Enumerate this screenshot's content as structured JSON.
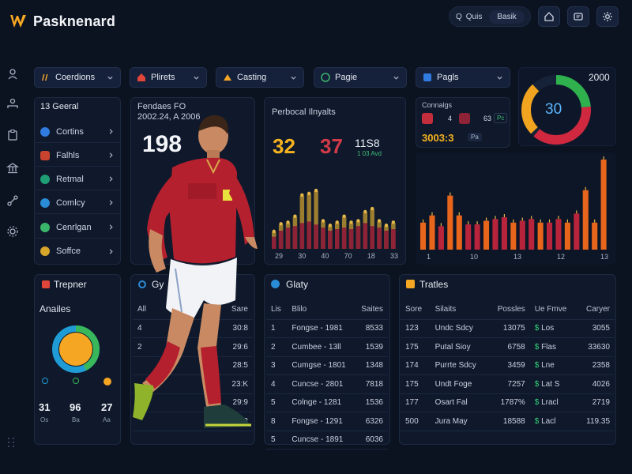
{
  "app": {
    "name": "Pasknenard"
  },
  "top": {
    "search_icon_text": "Q",
    "search_text": "Quis",
    "search_pill": "Basik"
  },
  "filters": [
    {
      "label": "Coerdions"
    },
    {
      "label": "Plirets"
    },
    {
      "label": "Casting"
    },
    {
      "label": "Pagie"
    },
    {
      "label": "Pagls"
    }
  ],
  "nav": {
    "header": "13 Geeral",
    "items": [
      {
        "label": "Cortins"
      },
      {
        "label": "Falhls"
      },
      {
        "label": "Retmal"
      },
      {
        "label": "Comlcy"
      },
      {
        "label": "Cenrlgan"
      },
      {
        "label": "Soffce"
      }
    ]
  },
  "player_card": {
    "title": "Fendaes FO",
    "subtitle": "2002.24, A 2006",
    "value": "198"
  },
  "stats_card": {
    "title": "Perbocal Ilnyalts",
    "val1": "32",
    "val2": "37",
    "val3": "11S8",
    "val3_sub": "1 03 Avd"
  },
  "bar_chart_1": {
    "x_ticks": [
      "29",
      "30",
      "40",
      "70",
      "18",
      "33"
    ]
  },
  "chart_data": [
    {
      "type": "bar",
      "title": "",
      "x_ticks": [
        "29",
        "30",
        "40",
        "70",
        "18",
        "33"
      ],
      "series": [
        {
          "values": [
            22,
            32,
            34,
            42,
            70,
            72,
            76,
            36,
            30,
            34,
            42,
            34,
            36,
            48,
            52,
            36,
            30,
            34
          ]
        },
        {
          "values": [
            16,
            24,
            28,
            30,
            34,
            36,
            32,
            28,
            24,
            26,
            28,
            26,
            30,
            34,
            30,
            28,
            24,
            26
          ]
        }
      ],
      "ylim": [
        0,
        100
      ],
      "colors": [
        "#9b7d2f",
        "#8e2236"
      ]
    },
    {
      "type": "bar",
      "title": "",
      "x_ticks": [
        "1",
        "10",
        "13",
        "12",
        "13"
      ],
      "values": [
        30,
        38,
        26,
        60,
        38,
        28,
        28,
        32,
        34,
        36,
        30,
        32,
        34,
        30,
        30,
        34,
        30,
        40,
        66,
        30,
        100
      ],
      "ylim": [
        0,
        100
      ],
      "colors": [
        "#e8651c",
        "#b8243c"
      ]
    }
  ],
  "right_card": {
    "label": "Connalgs",
    "badge1": "4",
    "badge2": "63",
    "badge2_sub": "Pc",
    "value": "3003:3",
    "value_tag": "Pa",
    "donut_year": "2000",
    "donut_value": "30",
    "x_ticks": [
      "1",
      "10",
      "13",
      "12",
      "13"
    ]
  },
  "tipster": {
    "title": "Trepner",
    "subtitle": "Anailes",
    "stats": [
      {
        "value": "31",
        "label": "Os"
      },
      {
        "value": "96",
        "label": "Ba"
      },
      {
        "value": "27",
        "label": "Aa"
      }
    ]
  },
  "middle_table": {
    "title": "Gy",
    "headers": [
      "All",
      "Sare"
    ],
    "rows": [
      {
        "a": "4",
        "b": "30:8"
      },
      {
        "a": "2",
        "b": "29:6"
      },
      {
        "a": "",
        "b": "28:5"
      },
      {
        "a": "",
        "b": "23:K"
      },
      {
        "a": "",
        "b": "29:9"
      },
      {
        "a": "",
        "b": "26:3"
      }
    ]
  },
  "glory_table": {
    "title": "Glaty",
    "headers": [
      "Lis",
      "Blilo",
      "Saites"
    ],
    "rows": [
      {
        "a": "1",
        "b": "Fongse - 1981",
        "c": "8533"
      },
      {
        "a": "2",
        "b": "Cumbee - 13ll",
        "c": "1539"
      },
      {
        "a": "3",
        "b": "Cumgse - 1801",
        "c": "1348"
      },
      {
        "a": "4",
        "b": "Cuncse - 2801",
        "c": "7818"
      },
      {
        "a": "5",
        "b": "Colnge - 1281",
        "c": "1536"
      },
      {
        "a": "8",
        "b": "Fongse - 1291",
        "c": "6326"
      },
      {
        "a": "5",
        "b": "Cuncse - 1891",
        "c": "6036"
      }
    ]
  },
  "trades_table": {
    "title": "Tratles",
    "headers": [
      "Sore",
      "Silaits",
      "Possles",
      "Ue Fmve",
      "Caryer"
    ],
    "rows": [
      {
        "a": "123",
        "b": "Undc Sdcy",
        "c": "13075",
        "d": "Los",
        "e": "3055"
      },
      {
        "a": "175",
        "b": "Putal Sioy",
        "c": "6758",
        "d": "Flas",
        "e": "33630"
      },
      {
        "a": "174",
        "b": "Purrte Sdcy",
        "c": "3459",
        "d": "Lne",
        "e": "2358"
      },
      {
        "a": "175",
        "b": "Undt Foge",
        "c": "7257",
        "d": "Lat S",
        "e": "4026"
      },
      {
        "a": "177",
        "b": "Osart Fal",
        "c": "1787%",
        "d": "Lracl",
        "e": "2719"
      },
      {
        "a": "500",
        "b": "Jura May",
        "c": "18588",
        "d": "Lacl",
        "e": "119.35"
      }
    ]
  }
}
